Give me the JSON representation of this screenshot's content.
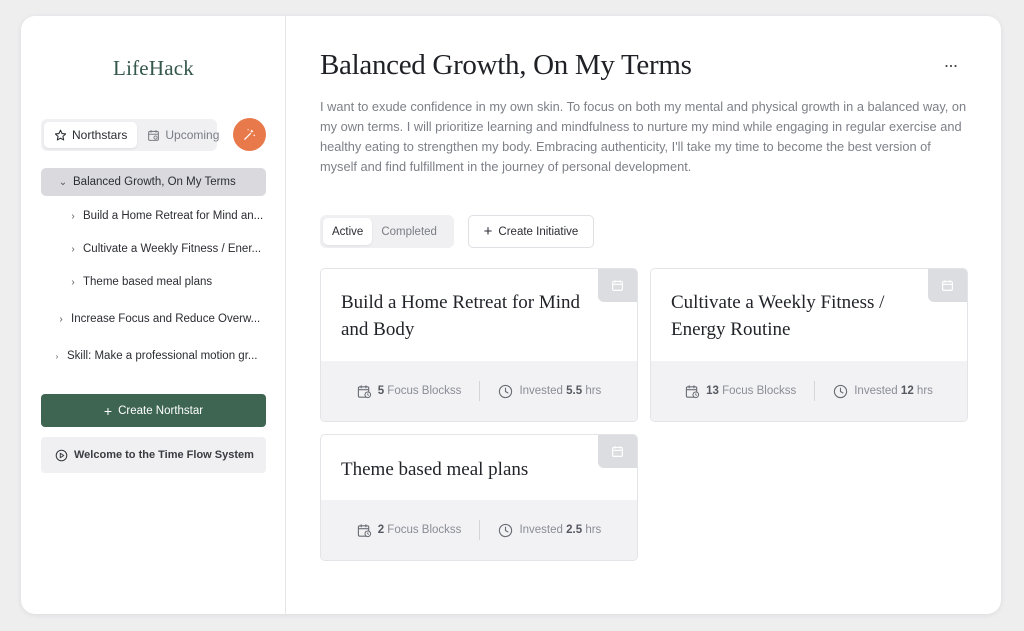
{
  "app": {
    "logo": "LifeHack"
  },
  "sidebar": {
    "tabs": [
      {
        "label": "Northstars",
        "icon": "star-icon",
        "active": true
      },
      {
        "label": "Upcoming",
        "icon": "calendar-icon",
        "active": false
      }
    ],
    "fab_icon": "sparkle-icon",
    "tree": [
      {
        "label": "Balanced Growth, On My Terms",
        "expanded": true,
        "selected": true
      },
      {
        "label": "Build a Home Retreat for Mind an..."
      },
      {
        "label": "Cultivate a Weekly Fitness / Ener..."
      },
      {
        "label": "Theme based meal plans"
      },
      {
        "label": "Increase Focus and Reduce Overw..."
      },
      {
        "label": "Skill: Make a professional motion gr..."
      }
    ],
    "create_button": "Create Northstar",
    "welcome_button": "Welcome to the Time Flow System"
  },
  "main": {
    "title": "Balanced Growth, On My Terms",
    "more_icon": "more-horizontal-icon",
    "description": "I want to exude confidence in my own skin. To focus on both my mental and physical growth in a balanced way, on my own terms. I will prioritize learning and mindfulness to nurture my mind while engaging in regular exercise and healthy eating to strengthen my body. Embracing authenticity, I'll take my time to become the best version of myself and find fulfillment in the journey of personal development.",
    "tabs": [
      {
        "label": "Active",
        "active": true
      },
      {
        "label": "Completed",
        "active": false
      }
    ],
    "create_initiative": "Create Initiative",
    "cards": [
      {
        "title": "Build a Home Retreat for Mind and Body",
        "focus_count": "5",
        "focus_label": "Focus Blockss",
        "invested_label": "Invested",
        "invested_value": "5.5",
        "invested_unit": "hrs"
      },
      {
        "title": "Cultivate a Weekly Fitness / Energy Routine",
        "focus_count": "13",
        "focus_label": "Focus Blockss",
        "invested_label": "Invested",
        "invested_value": "12",
        "invested_unit": "hrs"
      },
      {
        "title": "Theme based meal plans",
        "focus_count": "2",
        "focus_label": "Focus Blockss",
        "invested_label": "Invested",
        "invested_value": "2.5",
        "invested_unit": "hrs"
      }
    ]
  },
  "colors": {
    "accent_green": "#3d6552",
    "accent_orange": "#e8794a",
    "logo": "#33574a"
  }
}
